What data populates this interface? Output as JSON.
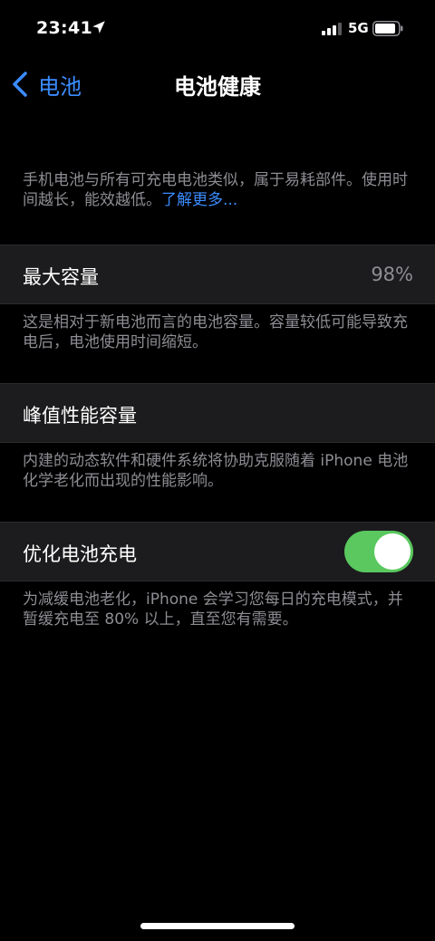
{
  "status": {
    "time": "23:41",
    "network": "5G",
    "icons": [
      "location-arrow-icon",
      "cellular-signal-icon",
      "battery-icon"
    ]
  },
  "nav": {
    "back_label": "电池",
    "title": "电池健康"
  },
  "intro": {
    "text": "手机电池与所有可充电电池类似，属于易耗部件。使用时间越长，能效越低。",
    "link": "了解更多..."
  },
  "max_capacity": {
    "label": "最大容量",
    "value": "98%",
    "note": "这是相对于新电池而言的电池容量。容量较低可能导致充电后，电池使用时间缩短。"
  },
  "peak_performance": {
    "label": "峰值性能容量",
    "note": "内建的动态软件和硬件系统将协助克服随着 iPhone 电池化学老化而出现的性能影响。"
  },
  "optimized_charging": {
    "label": "优化电池充电",
    "enabled": true,
    "note": "为减缓电池老化，iPhone 会学习您每日的充电模式，并暂缓充电至 80% 以上，直至您有需要。"
  },
  "colors": {
    "accent": "#3b8cff",
    "toggle_on": "#5ac85f",
    "secondary_text": "#8d8d93",
    "cell_bg": "#1c1c1e"
  }
}
